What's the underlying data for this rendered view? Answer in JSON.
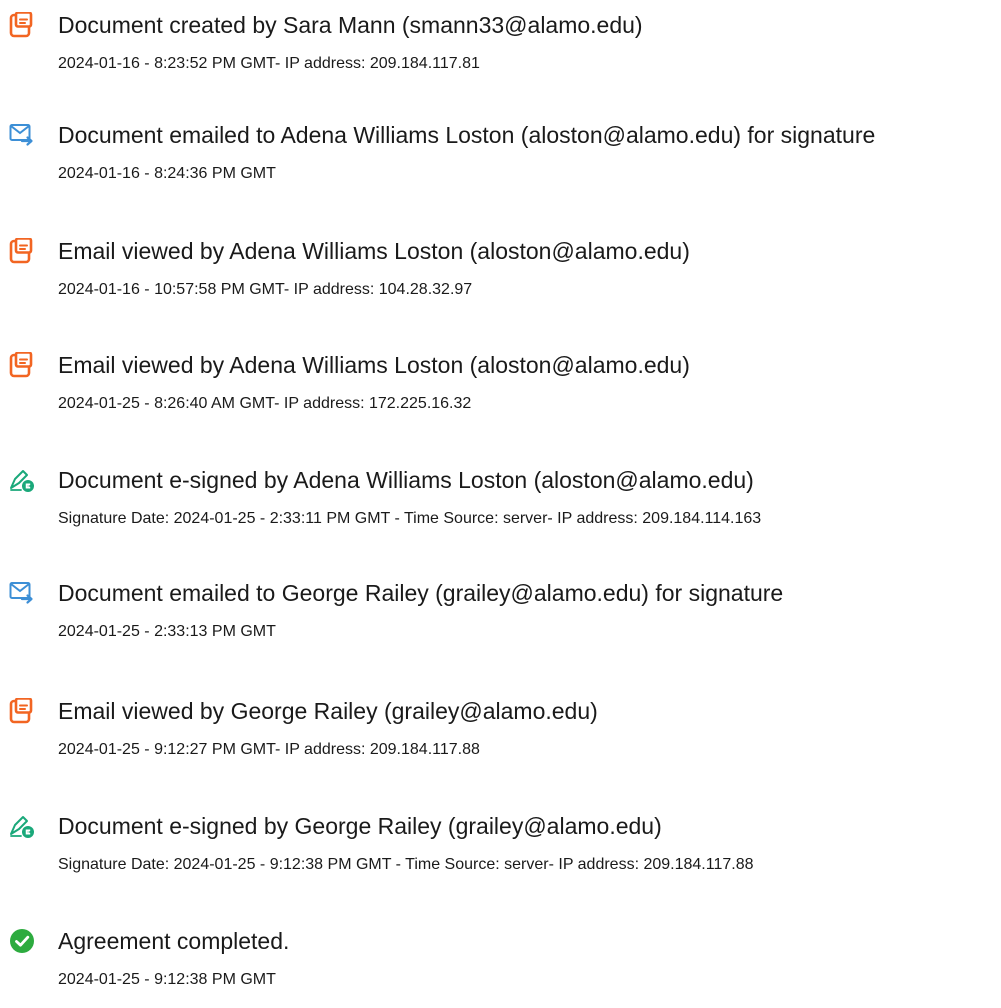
{
  "colors": {
    "document_icon": "#f26522",
    "email_icon": "#3d8fd6",
    "sign_icon": "#1aa87a",
    "complete_icon": "#2dab3f",
    "text": "#1a1a1a"
  },
  "events": [
    {
      "icon": "document-icon",
      "title": "Document created by Sara Mann (smann33@alamo.edu)",
      "detail": "2024-01-16 - 8:23:52 PM GMT- IP address: 209.184.117.81"
    },
    {
      "icon": "email-sent-icon",
      "title": "Document emailed to Adena Williams Loston (aloston@alamo.edu) for signature",
      "detail": "2024-01-16 - 8:24:36 PM GMT"
    },
    {
      "icon": "document-icon",
      "title": "Email viewed by Adena Williams Loston (aloston@alamo.edu)",
      "detail": "2024-01-16 - 10:57:58 PM GMT- IP address: 104.28.32.97"
    },
    {
      "icon": "document-icon",
      "title": "Email viewed by Adena Williams Loston (aloston@alamo.edu)",
      "detail": "2024-01-25 - 8:26:40 AM GMT- IP address: 172.225.16.32"
    },
    {
      "icon": "e-sign-pen-icon",
      "title": "Document e-signed by Adena Williams Loston (aloston@alamo.edu)",
      "detail": "Signature Date: 2024-01-25 - 2:33:11 PM GMT - Time Source: server- IP address: 209.184.114.163"
    },
    {
      "icon": "email-sent-icon",
      "title": "Document emailed to George Railey (grailey@alamo.edu) for signature",
      "detail": "2024-01-25 - 2:33:13 PM GMT"
    },
    {
      "icon": "document-icon",
      "title": "Email viewed by George Railey (grailey@alamo.edu)",
      "detail": "2024-01-25 - 9:12:27 PM GMT- IP address: 209.184.117.88"
    },
    {
      "icon": "e-sign-pen-icon",
      "title": "Document e-signed by George Railey (grailey@alamo.edu)",
      "detail": "Signature Date: 2024-01-25 - 9:12:38 PM GMT - Time Source: server- IP address: 209.184.117.88"
    },
    {
      "icon": "checkmark-circle-icon",
      "title": "Agreement completed.",
      "detail": "2024-01-25 - 9:12:38 PM GMT"
    }
  ]
}
